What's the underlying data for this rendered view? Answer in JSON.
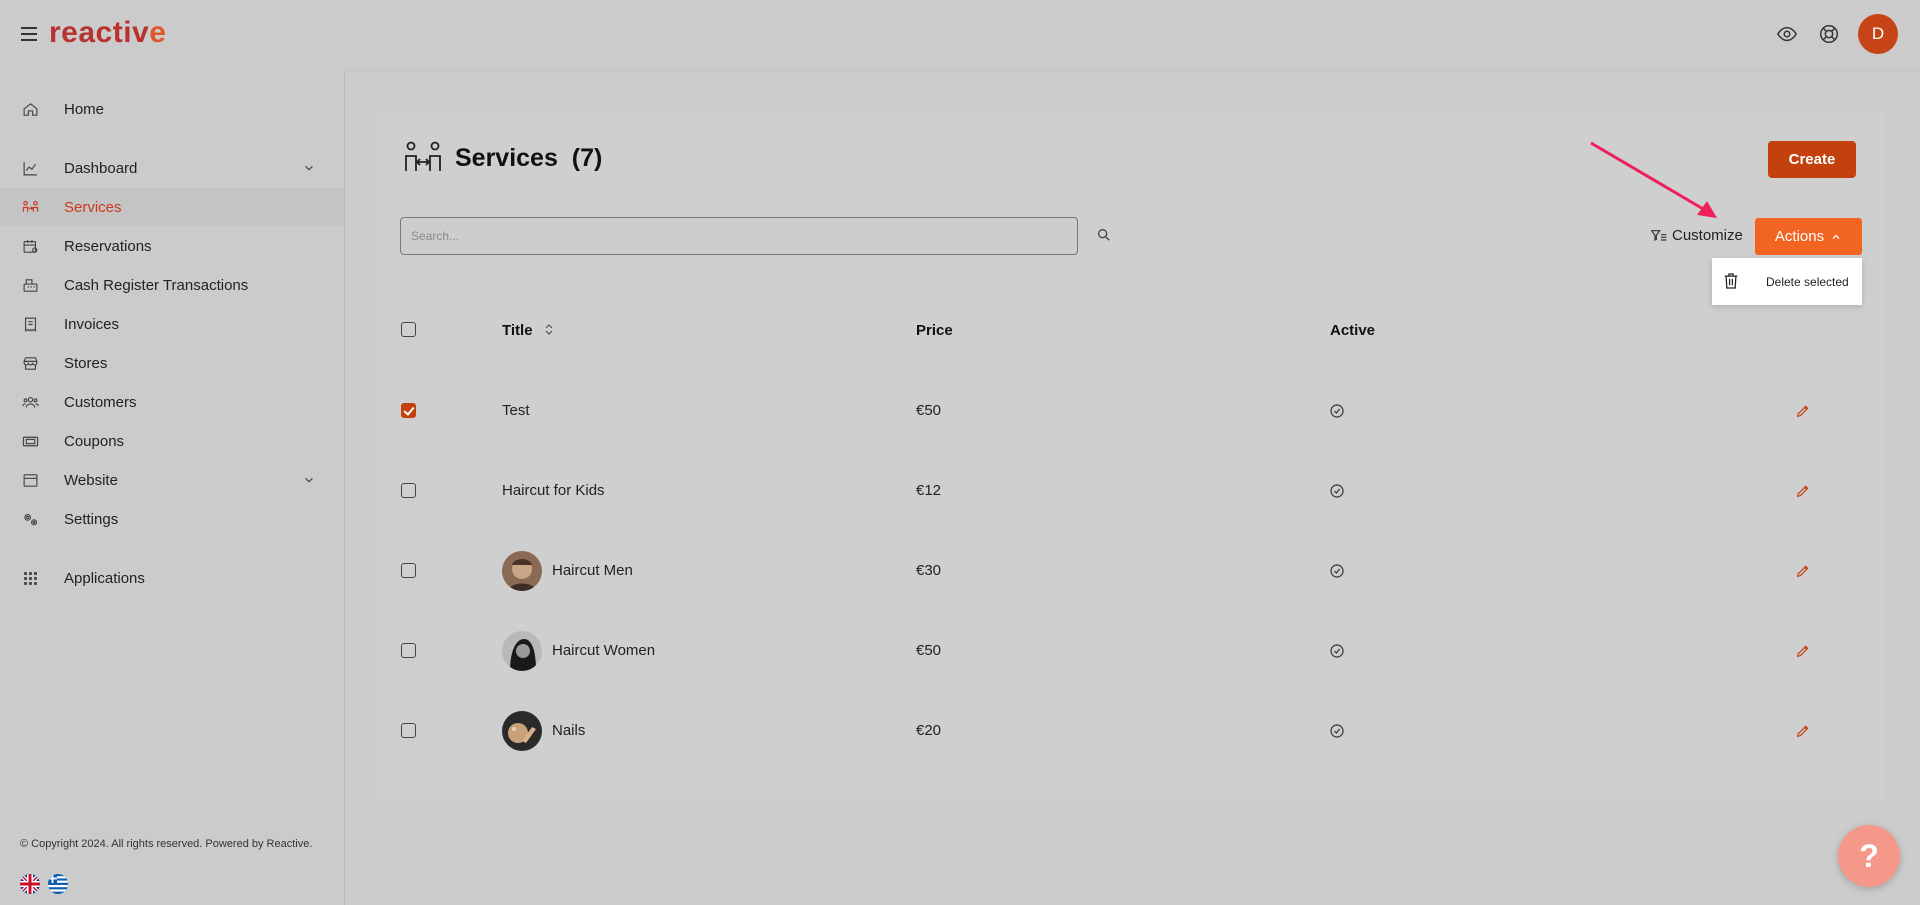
{
  "app": {
    "logo_text": "reactive",
    "brand_color": "#c2410c",
    "accent_color": "#f26422"
  },
  "header": {
    "menu_icon": "hamburger-icon",
    "preview_icon": "eye-icon",
    "support_icon": "lifebuoy-icon",
    "avatar_initial": "D"
  },
  "sidebar": {
    "items": [
      {
        "label": "Home",
        "icon": "home-icon"
      },
      {
        "label": "Dashboard",
        "icon": "chart-icon",
        "expandable": true
      },
      {
        "label": "Services",
        "icon": "services-icon",
        "active": true
      },
      {
        "label": "Reservations",
        "icon": "calendar-icon"
      },
      {
        "label": "Cash Register Transactions",
        "icon": "cash-register-icon"
      },
      {
        "label": "Invoices",
        "icon": "invoice-icon"
      },
      {
        "label": "Stores",
        "icon": "store-icon"
      },
      {
        "label": "Customers",
        "icon": "customers-icon"
      },
      {
        "label": "Coupons",
        "icon": "coupon-icon"
      },
      {
        "label": "Website",
        "icon": "website-icon",
        "expandable": true
      },
      {
        "label": "Settings",
        "icon": "settings-icon"
      },
      {
        "label": "Applications",
        "icon": "grid-icon"
      }
    ],
    "copyright": "© Copyright 2024. All rights reserved. Powered by Reactive.",
    "languages": [
      "uk-flag-icon",
      "greece-flag-icon"
    ]
  },
  "page": {
    "title": "Services",
    "count": "(7)",
    "create_label": "Create",
    "search_placeholder": "Search...",
    "customize_label": "Customize",
    "actions_label": "Actions",
    "actions_menu": [
      {
        "label": "Delete selected",
        "icon": "trash-icon"
      }
    ]
  },
  "table": {
    "columns": {
      "title": "Title",
      "price": "Price",
      "active": "Active"
    },
    "rows": [
      {
        "title": "Test",
        "price": "€50",
        "checked": true,
        "thumb": null
      },
      {
        "title": "Haircut for Kids",
        "price": "€12",
        "checked": false,
        "thumb": null
      },
      {
        "title": "Haircut Men",
        "price": "€30",
        "checked": false,
        "thumb": "men"
      },
      {
        "title": "Haircut Women",
        "price": "€50",
        "checked": false,
        "thumb": "women"
      },
      {
        "title": "Nails",
        "price": "€20",
        "checked": false,
        "thumb": "nails"
      }
    ]
  },
  "help": {
    "label": "?"
  }
}
